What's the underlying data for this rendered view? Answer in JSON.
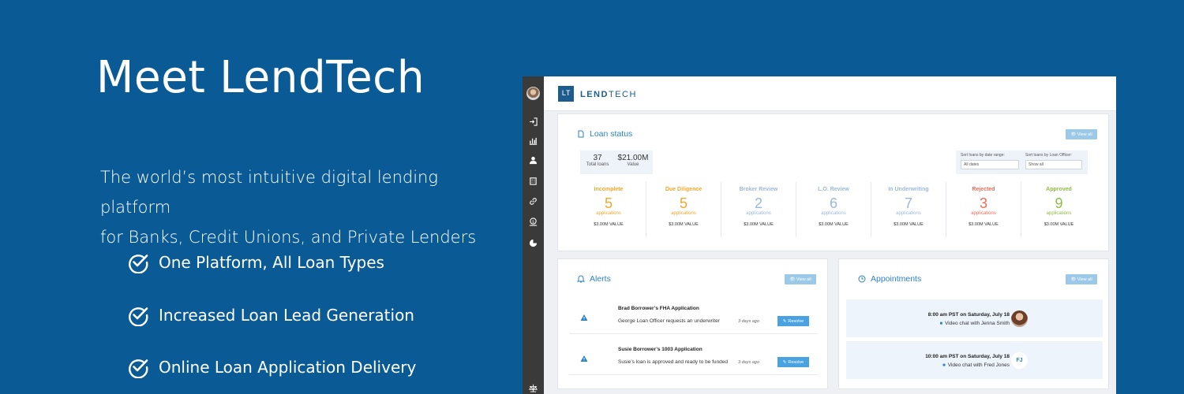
{
  "hero": {
    "title": "Meet LendTech",
    "subtitle_line1": "The world’s most intuitive digital lending platform",
    "subtitle_line2": "for Banks, Credit Unions, and Private Lenders",
    "features": [
      "One Platform, All Loan Types",
      "Increased Loan Lead Generation",
      "Online Loan Application Delivery"
    ]
  },
  "app": {
    "logo": {
      "mark": "LT",
      "brand_bold": "LEND",
      "brand_rest": "TECH"
    },
    "sidebar_icons": [
      "sign-in-icon",
      "chart-icon",
      "user-icon",
      "building-icon",
      "link-icon",
      "money-icon",
      "pie-chart-icon",
      "scale-icon"
    ],
    "loan_status": {
      "title": "Loan status",
      "view_all": "View all",
      "total_loans": "37",
      "total_loans_label": "Total loans",
      "value": "$21.00M",
      "value_label": "Value",
      "sort_date_label": "Sort loans by date range:",
      "sort_date_value": "All dates",
      "sort_officer_label": "Sort loans by Loan Officer:",
      "sort_officer_value": "Show all",
      "statuses": [
        {
          "name": "Incomplete",
          "count": "5",
          "unit": "applications",
          "value": "$3.00M VALUE",
          "color": "#f0a92e"
        },
        {
          "name": "Due Diligence",
          "count": "5",
          "unit": "applications",
          "value": "$3.00M VALUE",
          "color": "#f0a92e"
        },
        {
          "name": "Broker Review",
          "count": "2",
          "unit": "applications",
          "value": "$3.00M VALUE",
          "color": "#9bb8d6"
        },
        {
          "name": "L.O. Review",
          "count": "6",
          "unit": "applications",
          "value": "$3.00M VALUE",
          "color": "#9bb8d6"
        },
        {
          "name": "In Underwriting",
          "count": "7",
          "unit": "applications",
          "value": "$3.00M VALUE",
          "color": "#9bb8d6"
        },
        {
          "name": "Rejected",
          "count": "3",
          "unit": "applications",
          "value": "$3.00M VALUE",
          "color": "#ef6b5b"
        },
        {
          "name": "Approved",
          "count": "9",
          "unit": "applications",
          "value": "$3.00M VALUE",
          "color": "#8cbd45"
        }
      ]
    },
    "alerts": {
      "title": "Alerts",
      "view_all": "View all",
      "items": [
        {
          "title": "Brad Borrower’s FHA Application",
          "desc": "George Loan Officer requests an underwriter",
          "time": "3 days ago",
          "action": "Resolve"
        },
        {
          "title": "Susie Borrower’s 1003 Application",
          "desc": "Susie’s loan is approved and ready to be funded",
          "time": "3 days ago",
          "action": "Resolve"
        }
      ]
    },
    "appointments": {
      "title": "Appointments",
      "view_all": "View all",
      "items": [
        {
          "time": "8:00 am PST on Saturday, July 18",
          "who": "Video chat with Jenna Smith",
          "avatar": "photo"
        },
        {
          "time": "10:00 am PST on Saturday, July 18",
          "who": "Video chat with Fred Jones",
          "avatar": "FJ"
        }
      ]
    }
  }
}
